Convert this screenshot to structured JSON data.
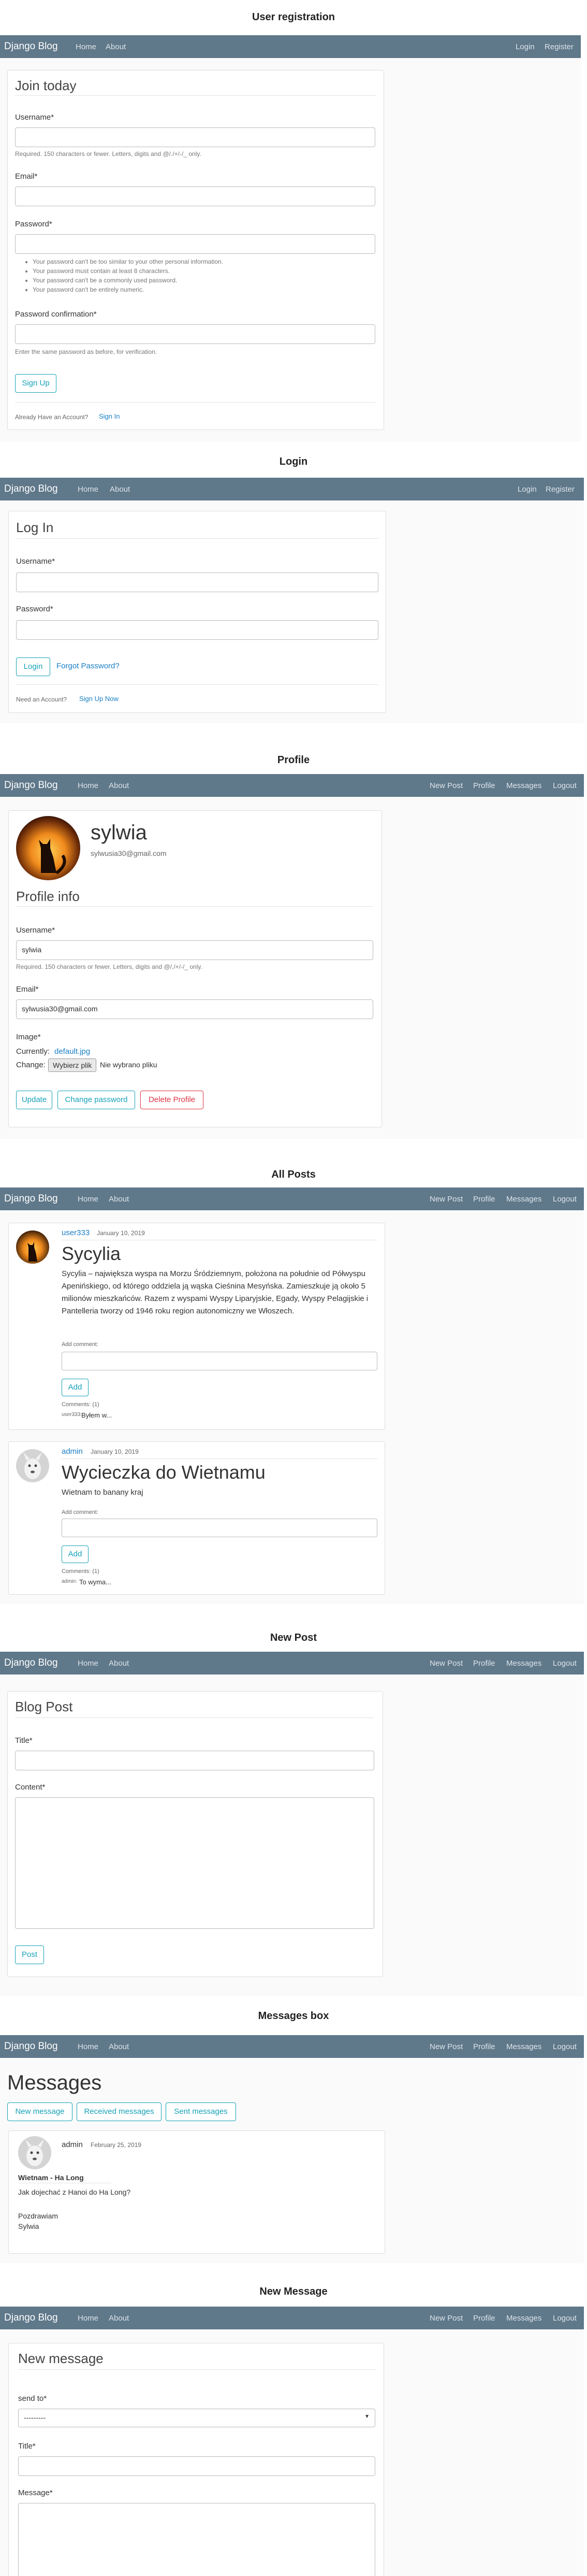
{
  "nav": {
    "brand": "Django Blog",
    "home": "Home",
    "about": "About",
    "login": "Login",
    "register": "Register",
    "new_post": "New Post",
    "profile": "Profile",
    "messages": "Messages",
    "logout": "Logout"
  },
  "registration": {
    "section_title": "User registration",
    "legend": "Join today",
    "username_label": "Username*",
    "username_hint": "Required. 150 characters or fewer. Letters, digits and @/./+/-/_ only.",
    "email_label": "Email*",
    "password_label": "Password*",
    "password_hints": [
      "Your password can't be too similar to your other personal information.",
      "Your password must contain at least 8 characters.",
      "Your password can't be a commonly used password.",
      "Your password can't be entirely numeric."
    ],
    "confirm_label": "Password confirmation*",
    "confirm_hint": "Enter the same password as before, for verification.",
    "submit": "Sign Up",
    "footer_text": "Already Have an Account?",
    "footer_link": "Sign In"
  },
  "login": {
    "section_title": "Login",
    "legend": "Log In",
    "username_label": "Username*",
    "password_label": "Password*",
    "submit": "Login",
    "forgot": "Forgot Password?",
    "footer_text": "Need an Account?",
    "footer_link": "Sign Up Now"
  },
  "profile": {
    "section_title": "Profile",
    "name": "sylwia",
    "email": "sylwusia30@gmail.com",
    "legend": "Profile info",
    "username_label": "Username*",
    "username_value": "sylwia",
    "username_hint": "Required. 150 characters or fewer. Letters, digits and @/./+/-/_ only.",
    "email_label": "Email*",
    "email_value": "sylwusia30@gmail.com",
    "image_label": "Image*",
    "currently_label": "Currently:",
    "currently_value": "default.jpg",
    "change_label": "Change:",
    "file_button": "Wybierz plik",
    "file_status": "Nie wybrano pliku",
    "update_btn": "Update",
    "change_pw_btn": "Change password",
    "delete_btn": "Delete Profile"
  },
  "all_posts": {
    "section_title": "All Posts",
    "posts": [
      {
        "author": "user333",
        "date": "January 10, 2019",
        "title": "Sycylia",
        "content": "Sycylia – największa wyspa na Morzu Śródziemnym, położona na południe od Półwyspu Apenińskiego, od którego oddziela ją wąska Cieśnina Mesyńska. Zamieszkuje ją około 5 milionów mieszkańców. Razem z wyspami Wyspy Liparyjskie, Egady, Wyspy Pelagijskie i Pantelleria tworzy od 1946 roku region autonomiczny we Włoszech.",
        "add_comment_label": "Add comment:",
        "add_btn": "Add",
        "comments_count": "Comments: (1)",
        "comment_author": "user333:",
        "comment_text": "Byłem w..."
      },
      {
        "author": "admin",
        "date": "January 10, 2019",
        "title": "Wycieczka do Wietnamu",
        "content": "Wietnam to bananу kraj",
        "add_comment_label": "Add comment:",
        "add_btn": "Add",
        "comments_count": "Comments: (1)",
        "comment_author": "admin:",
        "comment_text": "To wyma..."
      }
    ]
  },
  "new_post": {
    "section_title": "New Post",
    "legend": "Blog Post",
    "title_label": "Title*",
    "content_label": "Content*",
    "submit": "Post"
  },
  "messages_box": {
    "section_title": "Messages box",
    "heading": "Messages",
    "btn_new": "New message",
    "btn_received": "Received messages",
    "btn_sent": "Sent messages",
    "message": {
      "sender": "admin",
      "date": "February 25, 2019",
      "subject": "Wietnam - Ha Long",
      "body": "Jak dojechać z Hanoi do Ha Long?",
      "closing": "Pozdrawiam",
      "signature": "Sylwia"
    }
  },
  "new_message": {
    "section_title": "New Message",
    "legend": "New message",
    "send_to_label": "send to*",
    "send_to_value": "---------",
    "title_label": "Title*",
    "message_label": "Message*"
  }
}
